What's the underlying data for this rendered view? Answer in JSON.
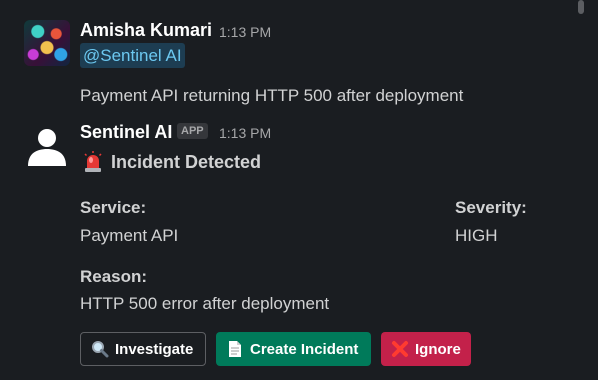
{
  "messages": [
    {
      "author": "Amisha Kumari",
      "time": "1:13 PM",
      "mention": "@Sentinel AI",
      "text": "Payment API returning HTTP 500 after deployment",
      "avatar": "user-photo-avatar"
    },
    {
      "author": "Sentinel AI",
      "badge": "APP",
      "time": "1:13 PM",
      "avatar": "default-user-avatar",
      "heading_icon": "police-siren-icon",
      "heading": "Incident Detected",
      "fields": {
        "service_label": "Service:",
        "service_value": "Payment API",
        "severity_label": "Severity:",
        "severity_value": "HIGH",
        "reason_label": "Reason:",
        "reason_value": "HTTP 500 error after deployment"
      },
      "actions": [
        {
          "label": "Investigate",
          "icon": "magnifying-glass-icon",
          "color": "#1a1d21"
        },
        {
          "label": "Create Incident",
          "icon": "page-icon",
          "color": "#007a5a"
        },
        {
          "label": "Ignore",
          "icon": "cross-mark-icon",
          "color": "#c3214a"
        }
      ]
    }
  ]
}
